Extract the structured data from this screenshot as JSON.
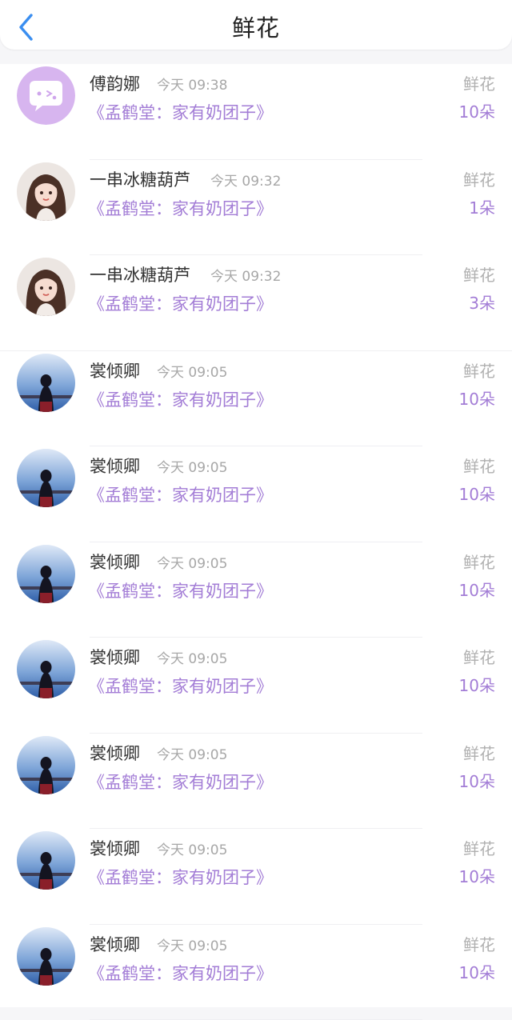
{
  "header": {
    "title": "鲜花",
    "back_icon": "chevron-left-icon",
    "accent_color": "#3a8ef0"
  },
  "colors": {
    "book_title": "#a37dd6",
    "count": "#a37dd6",
    "gift_label": "#b0b0b0",
    "time": "#a7a7a7",
    "name": "#333333",
    "avatar_chat_bg": "#d7b5ef"
  },
  "records": [
    {
      "user": "傅韵娜",
      "time": "今天 09:38",
      "book": "《孟鹤堂：家有奶团子》",
      "gift": "鲜花",
      "count": "10朵",
      "avatar": "chat-bubble-icon"
    },
    {
      "user": "一串冰糖葫芦",
      "time": "今天 09:32",
      "book": "《孟鹤堂：家有奶团子》",
      "gift": "鲜花",
      "count": "1朵",
      "avatar": "girl-portrait-avatar"
    },
    {
      "user": "一串冰糖葫芦",
      "time": "今天 09:32",
      "book": "《孟鹤堂：家有奶团子》",
      "gift": "鲜花",
      "count": "3朵",
      "avatar": "girl-portrait-avatar"
    },
    {
      "user": "裳倾卿",
      "time": "今天 09:05",
      "book": "《孟鹤堂：家有奶团子》",
      "gift": "鲜花",
      "count": "10朵",
      "avatar": "seaside-silhouette-avatar"
    },
    {
      "user": "裳倾卿",
      "time": "今天 09:05",
      "book": "《孟鹤堂：家有奶团子》",
      "gift": "鲜花",
      "count": "10朵",
      "avatar": "seaside-silhouette-avatar"
    },
    {
      "user": "裳倾卿",
      "time": "今天 09:05",
      "book": "《孟鹤堂：家有奶团子》",
      "gift": "鲜花",
      "count": "10朵",
      "avatar": "seaside-silhouette-avatar"
    },
    {
      "user": "裳倾卿",
      "time": "今天 09:05",
      "book": "《孟鹤堂：家有奶团子》",
      "gift": "鲜花",
      "count": "10朵",
      "avatar": "seaside-silhouette-avatar"
    },
    {
      "user": "裳倾卿",
      "time": "今天 09:05",
      "book": "《孟鹤堂：家有奶团子》",
      "gift": "鲜花",
      "count": "10朵",
      "avatar": "seaside-silhouette-avatar"
    },
    {
      "user": "裳倾卿",
      "time": "今天 09:05",
      "book": "《孟鹤堂：家有奶团子》",
      "gift": "鲜花",
      "count": "10朵",
      "avatar": "seaside-silhouette-avatar"
    },
    {
      "user": "裳倾卿",
      "time": "今天 09:05",
      "book": "《孟鹤堂：家有奶团子》",
      "gift": "鲜花",
      "count": "10朵",
      "avatar": "seaside-silhouette-avatar"
    }
  ]
}
